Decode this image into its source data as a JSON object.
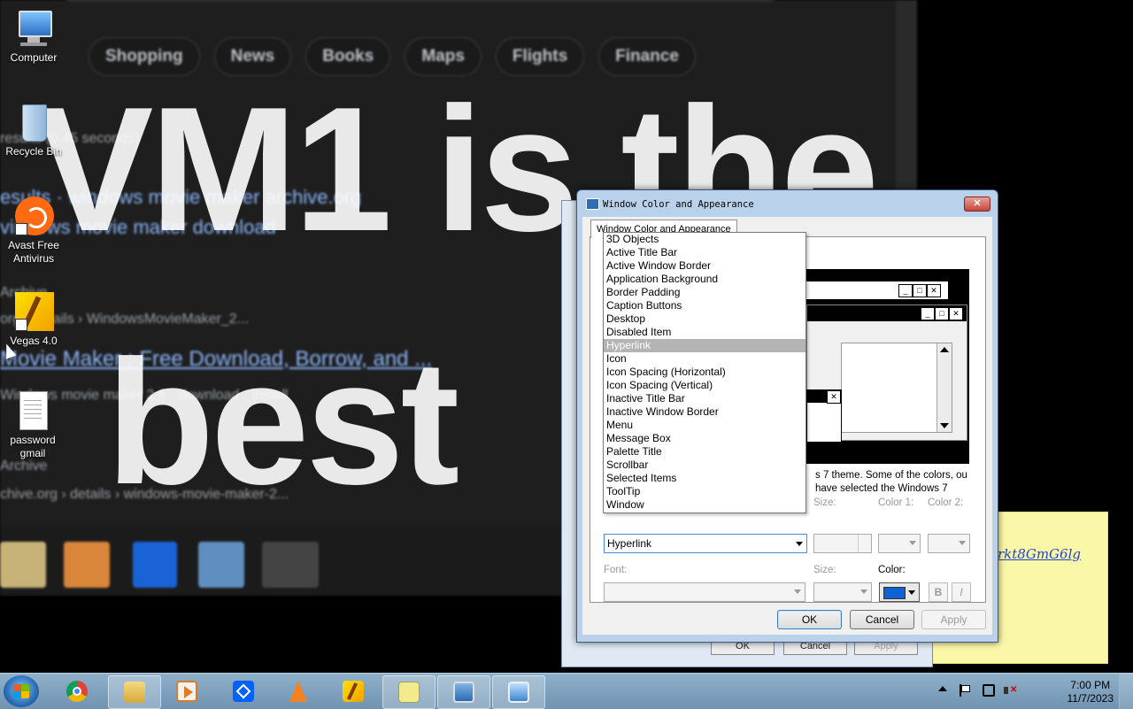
{
  "wallpaper": {
    "chips": [
      "Shopping",
      "News",
      "Books",
      "Maps",
      "Flights",
      "Finance"
    ],
    "text_line1": "VM1 is the",
    "text_line2": "best",
    "results": [
      "results (0.45 seconds)",
      "esults · windows movie maker archive.org",
      "vindows movie maker download",
      "Archive",
      "org › details › WindowsMovieMaker_2...",
      "Movie Maker : Free Download, Borrow, and ...",
      "Windows movie maker 2.6 · download · install",
      "Archive",
      "chive.org › details › windows-movie-maker-2..."
    ]
  },
  "desktop_icons": [
    {
      "label": "Computer"
    },
    {
      "label": "Recycle Bin"
    },
    {
      "label": "Avast Free Antivirus"
    },
    {
      "label": "Vegas 4.0"
    },
    {
      "label": "password gmail"
    }
  ],
  "sticky_note": {
    "text": "rkt8GmG6lg"
  },
  "back_dialog": {
    "ok": "OK",
    "cancel": "Cancel",
    "apply": "Apply"
  },
  "dialog": {
    "title": "Window Color and Appearance",
    "close": "✕",
    "tab": "Window Color and Appearance",
    "description": "s 7 theme.  Some of the colors, ou have selected the Windows 7",
    "item_selected": "Hyperlink",
    "items": [
      "3D Objects",
      "Active Title Bar",
      "Active Window Border",
      "Application Background",
      "Border Padding",
      "Caption Buttons",
      "Desktop",
      "Disabled Item",
      "Hyperlink",
      "Icon",
      "Icon Spacing (Horizontal)",
      "Icon Spacing (Vertical)",
      "Inactive Title Bar",
      "Inactive Window Border",
      "Menu",
      "Message Box",
      "Palette Title",
      "Scrollbar",
      "Selected Items",
      "ToolTip",
      "Window"
    ],
    "size_label": "Size:",
    "color1_label": "Color 1:",
    "color2_label": "Color 2:",
    "font_label": "Font:",
    "font_size_label": "Size:",
    "color_label": "Color:",
    "bold": "B",
    "italic": "I",
    "ok": "OK",
    "cancel": "Cancel",
    "apply": "Apply",
    "hyperlink_color": "#0f62d4"
  },
  "taskbar": {
    "clock_time": "7:00 PM",
    "clock_date": "11/7/2023",
    "apps": [
      "start-orb",
      "chrome",
      "windows-explorer",
      "media-player",
      "dropbox",
      "vlc",
      "vegas",
      "sticky-notes",
      "remote-desktop",
      "control-panel"
    ]
  }
}
